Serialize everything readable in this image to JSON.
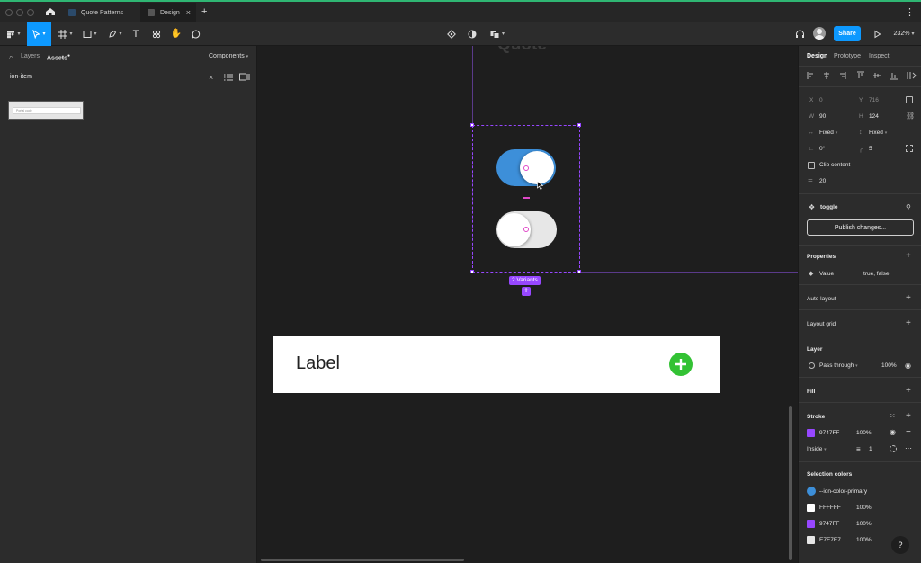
{
  "titlebar": {
    "tabs": [
      {
        "label": "Quote Patterns"
      },
      {
        "label": "Design"
      }
    ],
    "new_tab": "+",
    "more": "⋮"
  },
  "toolbar": {
    "share_label": "Share",
    "zoom": "232%"
  },
  "left_panel": {
    "tab_layers": "Layers",
    "tab_assets": "Assets",
    "components_dropdown": "Components",
    "search_value": "ion-item",
    "thumb_text": "Portal code"
  },
  "canvas": {
    "frame_title": "Quote",
    "variants_badge": "2 Variants",
    "label_text": "Label",
    "colors": {
      "primary": "#3d8fd9",
      "selection": "#9747FF",
      "add": "#33c234"
    }
  },
  "right_panel": {
    "tabs": {
      "design": "Design",
      "prototype": "Prototype",
      "inspect": "Inspect"
    },
    "x_label": "X",
    "x_value": "0",
    "y_label": "Y",
    "y_value": "716",
    "w_label": "W",
    "w_value": "90",
    "h_label": "H",
    "h_value": "124",
    "w_mode": "Fixed",
    "h_mode": "Fixed",
    "rotation": "0°",
    "radius": "5",
    "clip_content": "Clip content",
    "spacing": "20",
    "component_name": "toggle",
    "publish_label": "Publish changes...",
    "properties_title": "Properties",
    "prop_name": "Value",
    "prop_values": "true, false",
    "auto_layout": "Auto layout",
    "layout_grid": "Layout grid",
    "layer_title": "Layer",
    "blend_mode": "Pass through",
    "layer_opacity": "100%",
    "fill_title": "Fill",
    "stroke_title": "Stroke",
    "stroke_color": "9747FF",
    "stroke_opacity": "100%",
    "stroke_position": "Inside",
    "stroke_weight": "1",
    "selection_colors_title": "Selection colors",
    "selection_colors": [
      {
        "name": "--ion-color-primary",
        "hex": "#3d8fd9",
        "opacity": ""
      },
      {
        "name": "FFFFFF",
        "hex": "#FFFFFF",
        "opacity": "100%"
      },
      {
        "name": "9747FF",
        "hex": "#9747FF",
        "opacity": "100%"
      },
      {
        "name": "E7E7E7",
        "hex": "#E7E7E7",
        "opacity": "100%"
      }
    ],
    "help": "?"
  }
}
